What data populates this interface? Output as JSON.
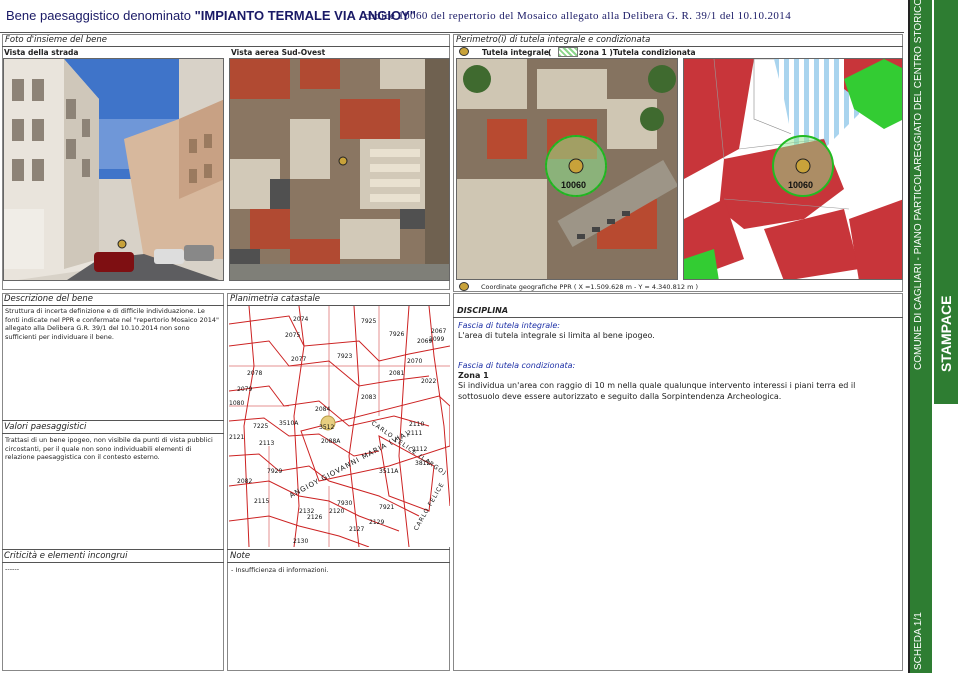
{
  "header": {
    "title_prefix": "Bene paesaggistico denominato ",
    "title_name": "\"IMPIANTO TERMALE VIA ANGIOY\"",
    "codice": "codice 10060 del repertorio del Mosaico allegato alla Delibera G. R. 39/1 del 10.10.2014"
  },
  "sections": {
    "foto_insieme": "Foto d'insieme del bene",
    "vista_strada": "Vista della strada",
    "vista_aerea": "Vista aerea Sud-Ovest",
    "perimetro": "Perimetro(i) di tutela integrale e condizionata",
    "descrizione": "Descrizione del bene",
    "planimetria": "Planimetria catastale",
    "valori": "Valori paesaggistici",
    "criticita": "Criticità e elementi incongrui",
    "note": "Note",
    "disciplina": "DISCIPLINA"
  },
  "legend": {
    "integrale": "Tutela integrale",
    "paren_open": "(",
    "zona": "zona 1 )",
    "condizionata": "Tutela condizionata"
  },
  "maps": {
    "code_left": "10060",
    "code_right": "10060",
    "coordinates": "Coordinate geografiche PPR ( X =1.509.628 m -   Y = 4.340.812 m )"
  },
  "descrizione_text": "Struttura di incerta definizione e di difficile individuazione. Le fonti indicate nel PPR e confermate nel \"repertorio Mosaico 2014\" allegato alla Delibera G.R. 39/1 del 10.10.2014 non sono sufficienti per individuare il bene.",
  "valori_text": "Trattasi di un bene ipogeo, non visibile da punti di vista pubblici circostanti, per il quale non sono individuabili elementi di relazione paesaggistica con il contesto esterno.",
  "criticita_text": "------",
  "note_text": "- Insufficienza di informazioni.",
  "disciplina": {
    "integrale_title": "Fascia di tutela integrale:",
    "integrale_text": "L'area di tutela integrale si limita al bene ipogeo.",
    "condizionata_title": "Fascia di tutela condizionata:",
    "zona": "Zona 1",
    "condizionata_text": "Si individua un'area con raggio di 10 m nella quale qualunque intervento interessi i piani terra ed il sottosuolo deve essere autorizzato e seguito dalla Sorpintendenza Archeologica."
  },
  "cadastral_labels": [
    "2074",
    "7925",
    "2075",
    "7926",
    "2069",
    "2067",
    "2077",
    "7923",
    "2078",
    "2081",
    "2070",
    "2079",
    "2083",
    "2084",
    "1080",
    "7225",
    "2110",
    "3510A",
    "2111",
    "2088A",
    "2112",
    "2113",
    "3511A",
    "7929",
    "3812",
    "2115",
    "7921",
    "7930",
    "2126",
    "2129",
    "2127",
    "2130",
    "2132",
    "2120",
    "2121",
    "3512",
    "2099",
    "2082",
    "2022"
  ],
  "street_labels": [
    "ANGIOY GIOVANNI MARIA (VIA)",
    "CARLO FELICE (LARGO)",
    "CARLO FELICE"
  ],
  "sidebar": {
    "comune": "COMUNE DI CAGLIARI - PIANO PARTICOLAREGGIATO DEL CENTRO STORICO",
    "quartiere": "STAMPACE",
    "scheda": "SCHEDA 1/1"
  },
  "colors": {
    "title_blue": "#1a1a66",
    "sidebar_green": "#2e7d32",
    "cadastral_red": "#cc2222",
    "tutela_green": "#33cc33",
    "building_red": "#c8353a",
    "stripe_blue": "#a9d4ee"
  }
}
